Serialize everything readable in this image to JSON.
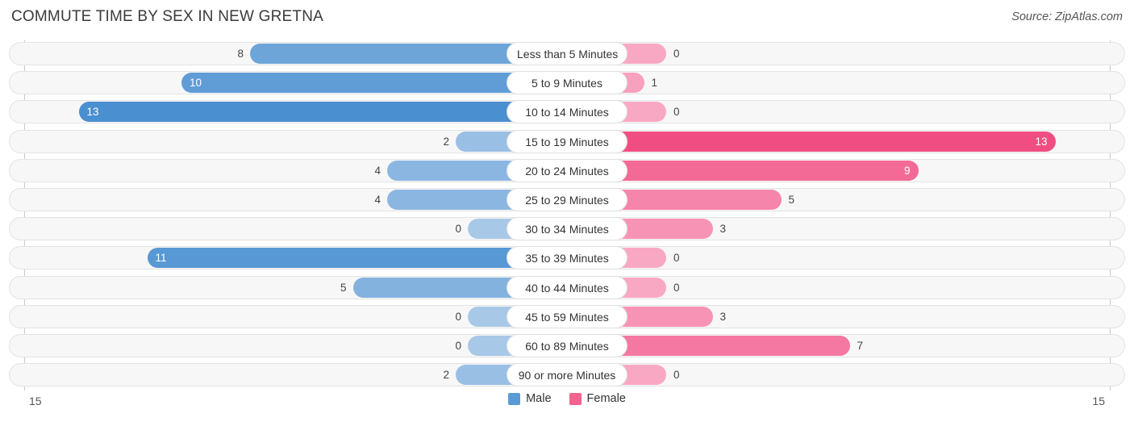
{
  "header": {
    "title": "COMMUTE TIME BY SEX IN NEW GRETNA",
    "source": "Source: ZipAtlas.com"
  },
  "axis": {
    "left_label": "15",
    "right_label": "15"
  },
  "legend": {
    "items": [
      {
        "label": "Male",
        "color": "#5b9bd5"
      },
      {
        "label": "Female",
        "color": "#f2638f"
      }
    ]
  },
  "chart_data": {
    "type": "bar",
    "subtype": "diverging-bidirectional",
    "title": "COMMUTE TIME BY SEX IN NEW GRETNA",
    "source": "Source: ZipAtlas.com",
    "xlabel": "",
    "ylabel": "",
    "xlim": [
      15,
      15
    ],
    "axis_max": 15,
    "grid": true,
    "legend_position": "bottom-center",
    "categories": [
      "Less than 5 Minutes",
      "5 to 9 Minutes",
      "10 to 14 Minutes",
      "15 to 19 Minutes",
      "20 to 24 Minutes",
      "25 to 29 Minutes",
      "30 to 34 Minutes",
      "35 to 39 Minutes",
      "40 to 44 Minutes",
      "45 to 59 Minutes",
      "60 to 89 Minutes",
      "90 or more Minutes"
    ],
    "series": [
      {
        "name": "Male",
        "direction": "left",
        "color": "#5b9bd5",
        "values": [
          8,
          10,
          13,
          2,
          4,
          4,
          0,
          11,
          5,
          0,
          0,
          2
        ]
      },
      {
        "name": "Female",
        "direction": "right",
        "color": "#f2638f",
        "values": [
          0,
          1,
          0,
          13,
          9,
          5,
          3,
          0,
          0,
          3,
          7,
          0
        ]
      }
    ]
  }
}
